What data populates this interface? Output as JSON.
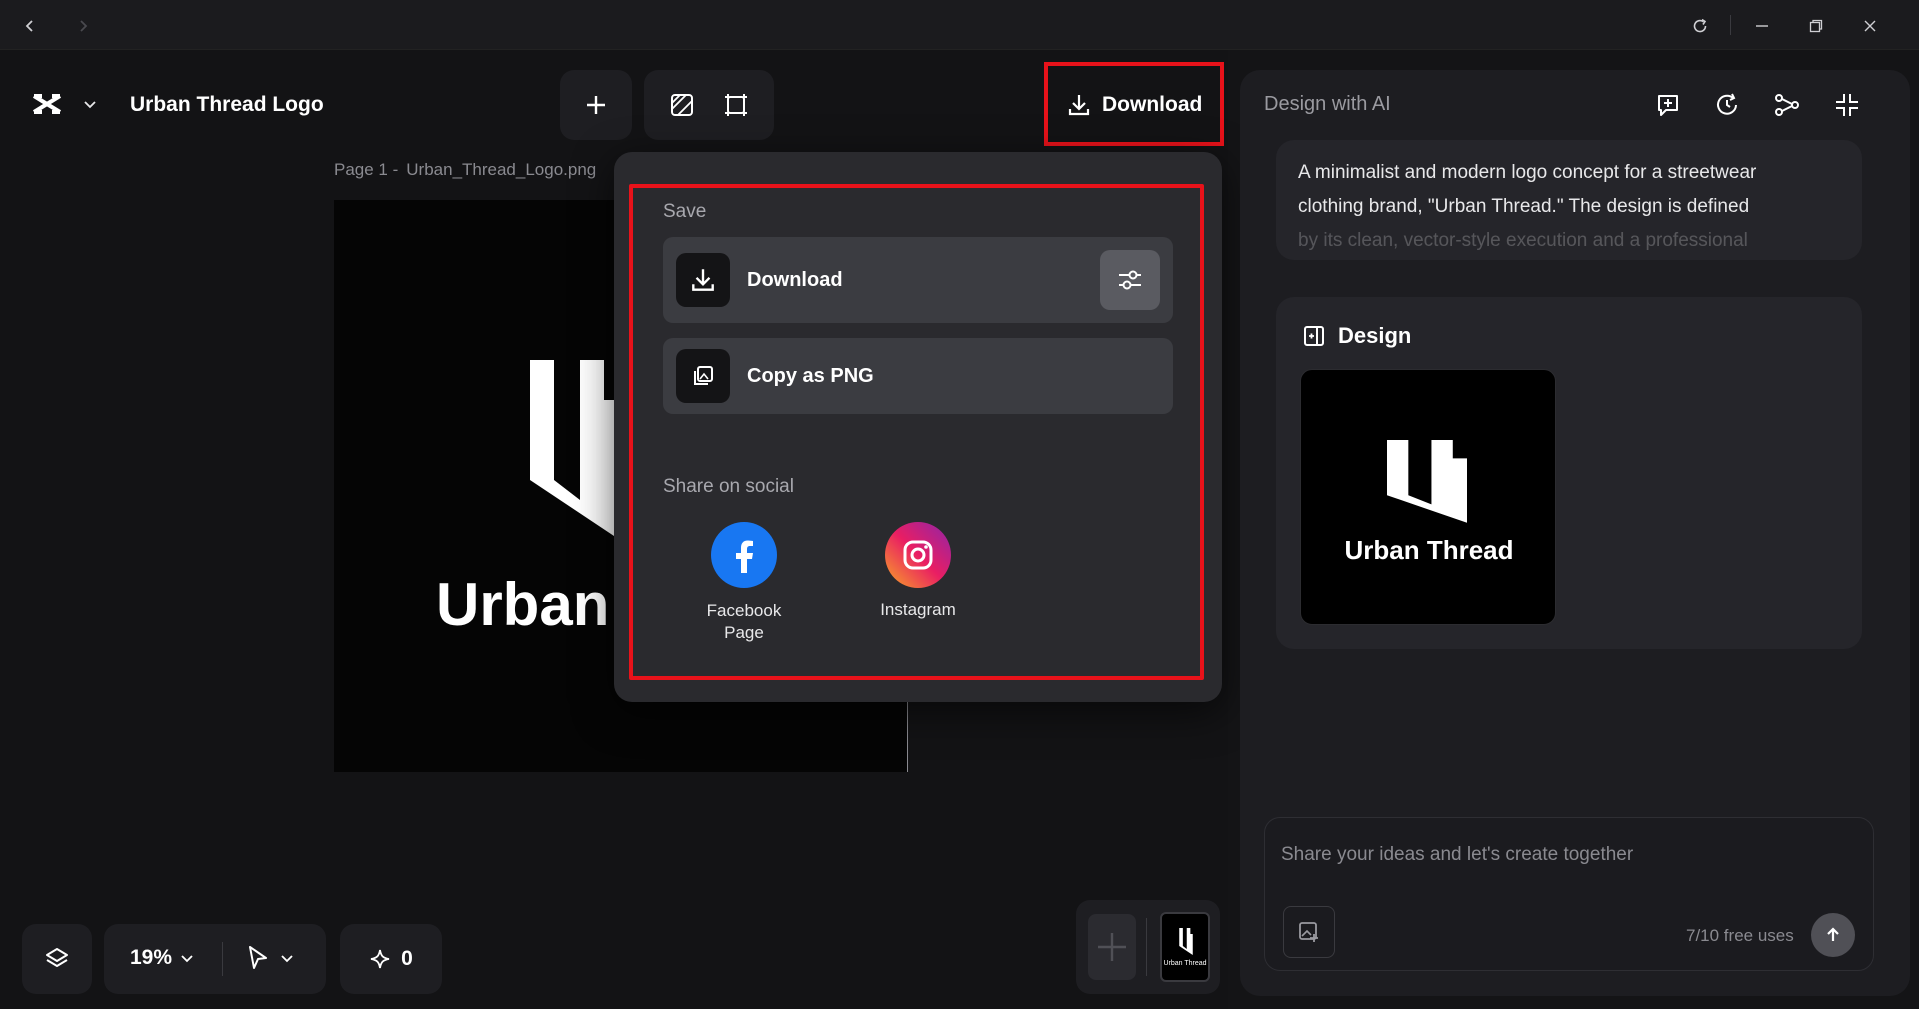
{
  "titlebar": {
    "back_icon": "chevron-left-icon",
    "forward_icon": "chevron-right-icon",
    "refresh_icon": "refresh-icon",
    "minimize_icon": "minimize-icon",
    "restore_icon": "restore-icon",
    "close_icon": "close-icon"
  },
  "toolbar": {
    "project_title": "Urban Thread Logo",
    "download_label": "Download"
  },
  "canvas": {
    "page_label": "Page 1 -",
    "file_name": "Urban_Thread_Logo.png",
    "logo_text": "Urban"
  },
  "download_menu": {
    "save_heading": "Save",
    "download_label": "Download",
    "copy_label": "Copy as PNG",
    "share_heading": "Share on social",
    "facebook_label_line1": "Facebook",
    "facebook_label_line2": "Page",
    "instagram_label": "Instagram"
  },
  "bottom_bar": {
    "zoom": "19%",
    "credits": "0",
    "thumb_text": "Urban Thread"
  },
  "ai_panel": {
    "title": "Design with AI",
    "prompt_line1": "A minimalist and modern logo concept for a streetwear",
    "prompt_line2": "clothing brand, \"Urban Thread.\" The design is defined",
    "prompt_line3": "by its clean, vector-style execution and a professional",
    "design_heading": "Design",
    "design_thumb_text": "Urban Thread",
    "input_placeholder": "Share your ideas and let's create together",
    "free_uses": "7/10 free uses"
  },
  "colors": {
    "highlight": "#e8121a",
    "facebook": "#1877f2",
    "panel_bg": "#1d1d21"
  }
}
